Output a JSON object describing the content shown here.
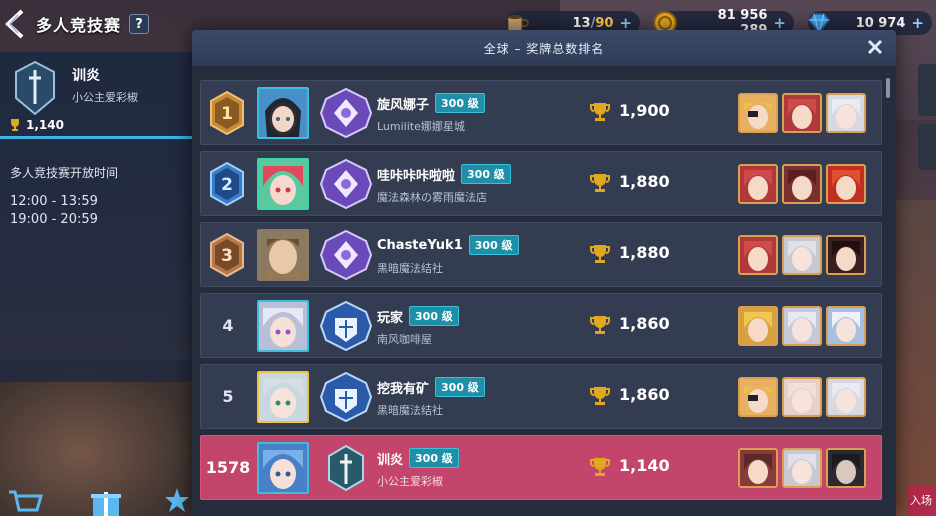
{
  "header": {
    "title": "多人竞技赛",
    "help_label": "?"
  },
  "currencies": [
    {
      "icon": "coffee-cup-icon",
      "value": "13",
      "max": "90",
      "plus": "+"
    },
    {
      "icon": "gold-coin-icon",
      "value": "81 956 289",
      "plus": "+"
    },
    {
      "icon": "diamond-icon",
      "value": "10 974",
      "plus": "+"
    }
  ],
  "player": {
    "name": "训炎",
    "guild": "小公主爱彩椒",
    "trophies": "1,140"
  },
  "open_time": {
    "label": "多人竞技赛开放时间",
    "slot1": "12:00 - 13:59",
    "slot2": "19:00 - 20:59"
  },
  "modal": {
    "title": "全球 – 奖牌总数排名",
    "close_icon": "close-icon"
  },
  "rankings": [
    {
      "rank": "1",
      "name": "旋风娜子",
      "level": "300 级",
      "guild": "Lumilite娜娜星城",
      "score": "1,900",
      "badge_color": "#c98a3a",
      "emblem": "purple"
    },
    {
      "rank": "2",
      "name": "哇咔咔咔啦啦",
      "level": "300 级",
      "guild": "魔法森林の雾雨魔法店",
      "score": "1,880",
      "badge_color": "#3a7ac9",
      "emblem": "purple"
    },
    {
      "rank": "3",
      "name": "ChasteYuk1",
      "level": "300 级",
      "guild": "黑暗魔法结社",
      "score": "1,880",
      "badge_color": "#b5784a",
      "emblem": "purple"
    },
    {
      "rank": "4",
      "name": "玩家",
      "level": "300 级",
      "guild": "南风咖啡屋",
      "score": "1,860",
      "emblem": "blue"
    },
    {
      "rank": "5",
      "name": "挖我有矿",
      "level": "300 级",
      "guild": "黑暗魔法结社",
      "score": "1,860",
      "emblem": "blue"
    },
    {
      "rank": "1578",
      "name": "训炎",
      "level": "300 级",
      "guild": "小公主爱彩椒",
      "score": "1,140",
      "emblem": "sword",
      "mine": true
    }
  ],
  "colors": {
    "highlight_row": "#c3456c",
    "level_badge": "#1f8fa8",
    "gold": "#d8a050"
  },
  "right_edge": {
    "enter_label": "入场"
  }
}
